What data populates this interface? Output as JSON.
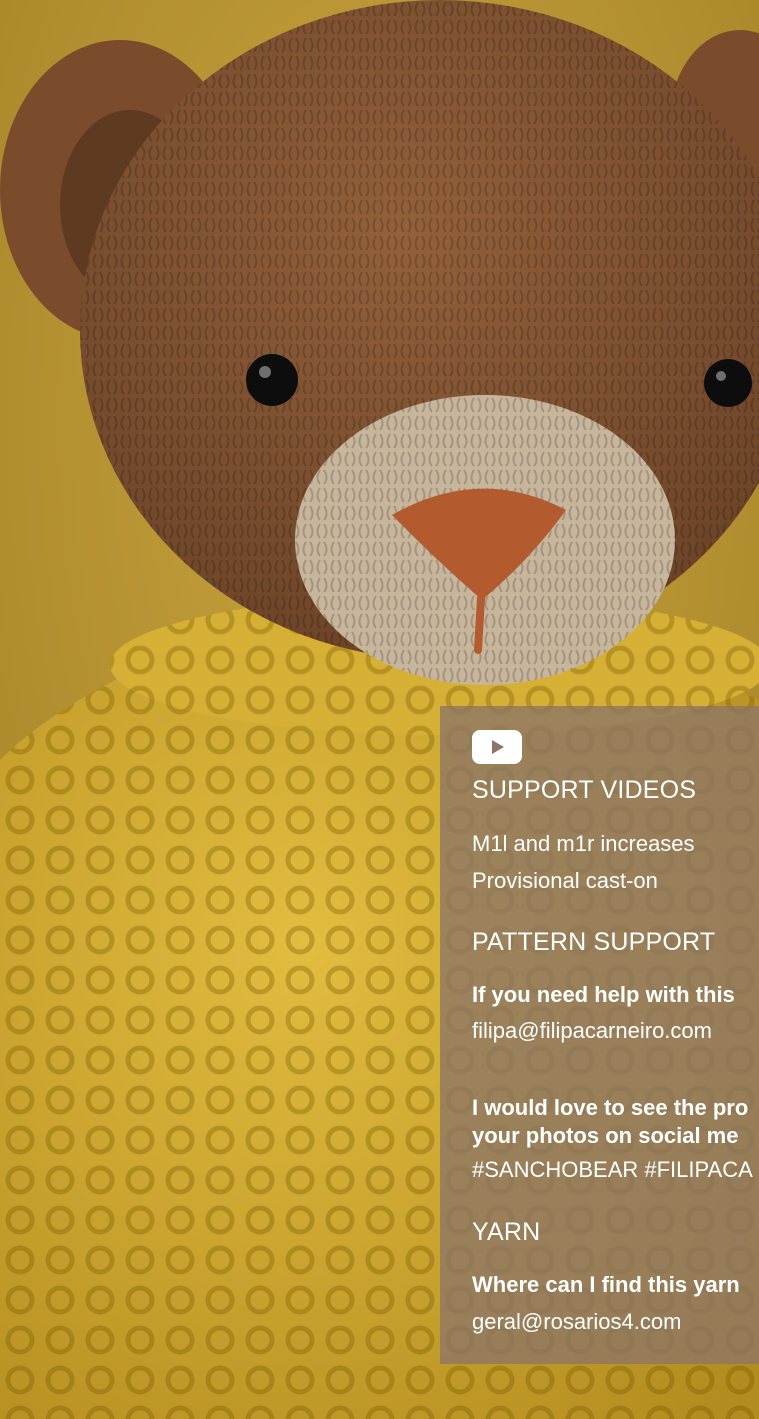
{
  "support_videos": {
    "icon": "youtube-icon",
    "heading": "SUPPORT VIDEOS",
    "links": [
      "M1l and m1r increases",
      "Provisional cast-on"
    ]
  },
  "pattern_support": {
    "heading": "PATTERN SUPPORT",
    "help_text": "If you need help with this",
    "email": "filipa@filipacarneiro.com",
    "social_line1": "I would love to see the pro",
    "social_line2": "your photos on social me",
    "hashtags": "#SANCHOBEAR #FILIPACA"
  },
  "yarn": {
    "heading": "YARN",
    "question": "Where can I find this yarn",
    "email": "geral@rosarios4.com"
  },
  "colors": {
    "panel": "#8c7666",
    "text": "#ffffff",
    "background": "#b9962e"
  }
}
